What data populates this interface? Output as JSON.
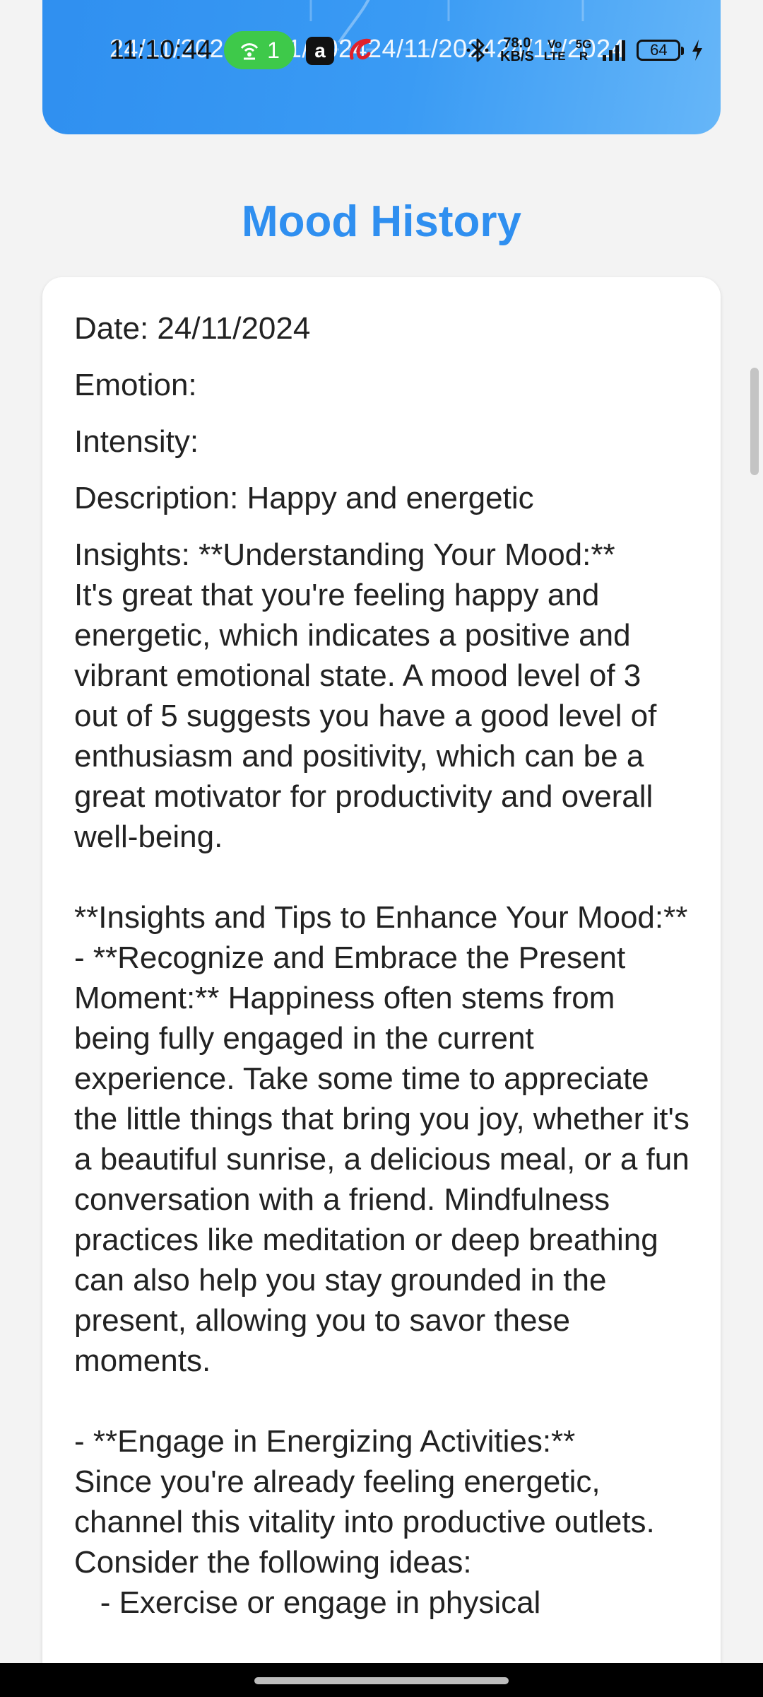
{
  "status_bar": {
    "time": "11:10:44",
    "hotspot_count": "1",
    "app_badge": "a",
    "net_speed_value": "78.0",
    "net_speed_unit": "KB/S",
    "volte_top": "Vo",
    "volte_bottom": "LTE",
    "network": "5G",
    "network_sub": "R",
    "battery": "64"
  },
  "header": {
    "date_row": "24/11/202424/11/202424/11/202424/11/2024"
  },
  "page": {
    "title": "Mood History"
  },
  "entry": {
    "date": "Date: 24/11/2024",
    "emotion": "Emotion:",
    "intensity": "Intensity:",
    "description": "Description: Happy and energetic",
    "insights": "Insights: **Understanding Your Mood:**\nIt's great that you're feeling happy and energetic, which indicates a positive and vibrant emotional state. A mood level of 3 out of 5 suggests you have a good level of enthusiasm and positivity, which can be a great motivator for productivity and overall well-being.\n\n**Insights and Tips to Enhance Your Mood:**\n- **Recognize and Embrace the Present Moment:** Happiness often stems from being fully engaged in the current experience. Take some time to appreciate the little things that bring you joy, whether it's a beautiful sunrise, a delicious meal, or a fun conversation with a friend. Mindfulness practices like meditation or deep breathing can also help you stay grounded in the present, allowing you to savor these moments.\n\n- **Engage in Energizing Activities:**\nSince you're already feeling energetic, channel this vitality into productive outlets. Consider the following ideas:\n   - Exercise or engage in physical"
  },
  "colors": {
    "accent": "#2f8ff0",
    "background": "#f3f3f3",
    "card": "#ffffff",
    "text": "#222222"
  }
}
